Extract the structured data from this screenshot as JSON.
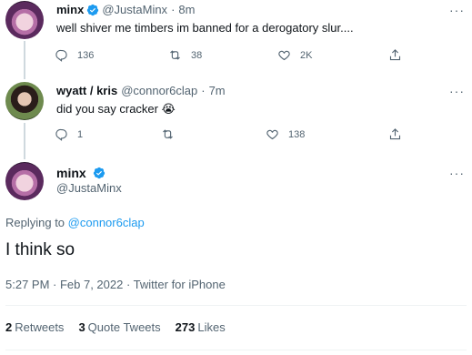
{
  "tweet1": {
    "name": "minx",
    "handle": "@JustaMinx",
    "dot": "·",
    "time": "8m",
    "text": "well shiver me timbers im banned for a derogatory slur....",
    "replies": "136",
    "retweets": "38",
    "likes": "2K"
  },
  "tweet2": {
    "name": "wyatt / kris",
    "handle": "@connor6clap",
    "dot": "·",
    "time": "7m",
    "text": "did you say cracker 😭",
    "replies": "1",
    "retweets": "",
    "likes": "138"
  },
  "main_tweet": {
    "name": "minx",
    "handle": "@JustaMinx",
    "replying_prefix": "Replying to ",
    "replying_to": "@connor6clap",
    "text": "I think so",
    "meta": "5:27 PM · Feb 7, 2022 · Twitter for iPhone",
    "retweets_count": "2",
    "retweets_label": "Retweets",
    "quotes_count": "3",
    "quotes_label": "Quote Tweets",
    "likes_count": "273",
    "likes_label": "Likes"
  },
  "more_label": "···",
  "colors": {
    "accent": "#1d9bf0",
    "muted": "#536471",
    "text": "#0f1419"
  }
}
